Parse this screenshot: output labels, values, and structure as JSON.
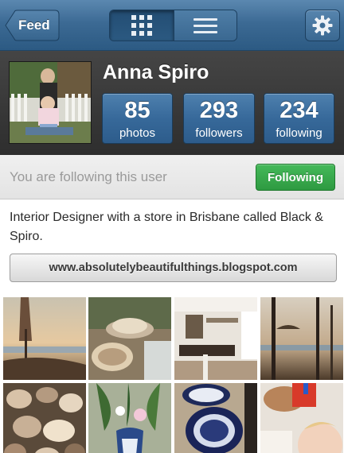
{
  "navbar": {
    "back_label": "Feed",
    "view_modes": [
      "grid",
      "list"
    ],
    "active_view": "grid",
    "settings_icon": "gear-icon",
    "accent": "#3c6a94"
  },
  "profile": {
    "name": "Anna Spiro",
    "stats": {
      "photos": {
        "value": "85",
        "label": "photos"
      },
      "followers": {
        "value": "293",
        "label": "followers"
      },
      "following": {
        "value": "234",
        "label": "following"
      }
    }
  },
  "follow": {
    "message": "You are following this user",
    "button_label": "Following",
    "button_color": "#2e9a41"
  },
  "bio": {
    "text": "Interior Designer with a store in Brisbane called Black & Spiro.",
    "website": "www.absolutelybeautifulthings.blogspot.com"
  },
  "grid": {
    "photos": [
      "beach-umbrella-sunset",
      "shell-bowl-table",
      "kitchen-interior",
      "beach-trees-sunset",
      "seashell-pile",
      "blue-vase-flowers",
      "blue-white-plates",
      "child-with-toy"
    ]
  }
}
